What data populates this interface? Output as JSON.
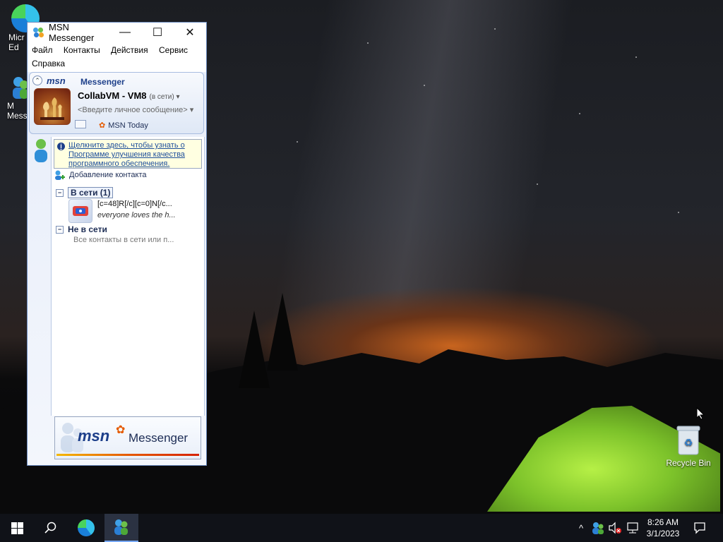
{
  "desktop": {
    "icons": [
      {
        "label": "Micr\nEd"
      },
      {
        "label": "M\nMess"
      },
      {
        "label": "Recycle Bin"
      }
    ]
  },
  "window": {
    "title": "MSN Messenger",
    "controls": {
      "minimize": "—",
      "maximize": "☐",
      "close": "✕"
    },
    "menu": [
      "Файл",
      "Контакты",
      "Действия",
      "Сервис",
      "Справка"
    ]
  },
  "header": {
    "logo": "msn",
    "product": "Messenger",
    "username": "CollabVM - VM8",
    "status": "(в сети) ▾",
    "personal_message": "<Введите личное сообщение> ▾",
    "today": "MSN Today"
  },
  "info_banner": {
    "text": "Щелкните здесь, чтобы узнать о Программе  улучшения качества программного обеспечения."
  },
  "add_contact": "Добавление контакта",
  "groups": {
    "online": {
      "label": "В сети (1)",
      "toggle": "−"
    },
    "offline": {
      "label": "Не в сети",
      "toggle": "−",
      "note": "Все контакты в сети или п..."
    }
  },
  "contact": {
    "name": "[c=48]R[/c][c=0]N[/c...",
    "message": "everyone loves the h..."
  },
  "ad": {
    "msn": "msn",
    "messenger": "Messenger"
  },
  "taskbar": {
    "time": "8:26 AM",
    "date": "3/1/2023",
    "tray_chevron": "^"
  },
  "colors": {
    "accent": "#1d3f8a",
    "taskbar": "#101218",
    "info_bg": "#ffffe1"
  }
}
